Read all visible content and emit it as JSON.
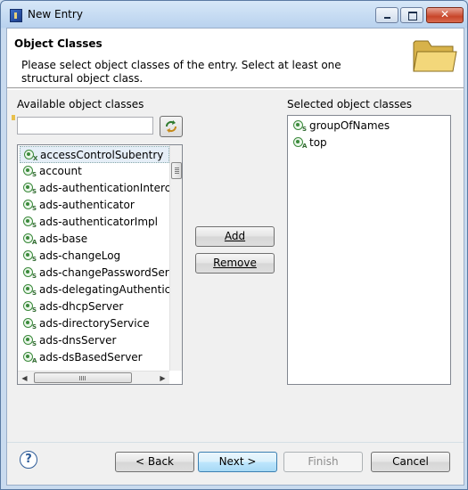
{
  "window": {
    "title": "New Entry",
    "close_glyph": "✕"
  },
  "header": {
    "title": "Object Classes",
    "description": "Please select object classes of the entry. Select at least one structural object class."
  },
  "available": {
    "label": "Available object classes",
    "search_value": "",
    "items": [
      {
        "name": "accessControlSubentry",
        "kind": "X"
      },
      {
        "name": "account",
        "kind": "S"
      },
      {
        "name": "ads-authenticationIntercep",
        "kind": "S"
      },
      {
        "name": "ads-authenticator",
        "kind": "S"
      },
      {
        "name": "ads-authenticatorImpl",
        "kind": "S"
      },
      {
        "name": "ads-base",
        "kind": "A"
      },
      {
        "name": "ads-changeLog",
        "kind": "S"
      },
      {
        "name": "ads-changePasswordServer",
        "kind": "S"
      },
      {
        "name": "ads-delegatingAuthenticato",
        "kind": "S"
      },
      {
        "name": "ads-dhcpServer",
        "kind": "S"
      },
      {
        "name": "ads-directoryService",
        "kind": "S"
      },
      {
        "name": "ads-dnsServer",
        "kind": "S"
      },
      {
        "name": "ads-dsBasedServer",
        "kind": "A"
      }
    ]
  },
  "selected": {
    "label": "Selected object classes",
    "items": [
      {
        "name": "groupOfNames",
        "kind": "S"
      },
      {
        "name": "top",
        "kind": "A"
      }
    ]
  },
  "buttons": {
    "add": "Add",
    "remove": "Remove",
    "back": "< Back",
    "next": "Next >",
    "finish": "Finish",
    "cancel": "Cancel"
  },
  "help_glyph": "?",
  "scroll": {
    "up": "▲",
    "down": "▼",
    "left": "◀",
    "right": "▶"
  }
}
